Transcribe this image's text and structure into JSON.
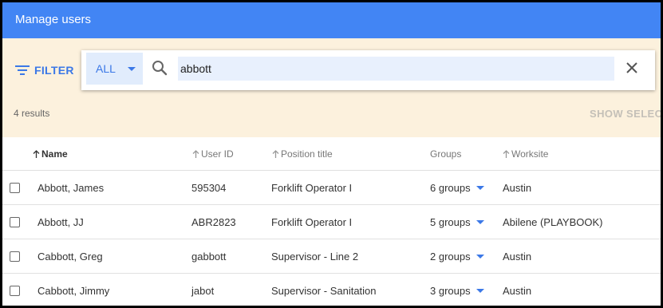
{
  "window": {
    "title": "Manage users"
  },
  "toolbar": {
    "filter_label": "FILTER",
    "scope_value": "ALL",
    "search_value": "abbott",
    "results_text": "4 results",
    "show_selected_label": "SHOW SELECTED"
  },
  "table": {
    "headers": {
      "name": "Name",
      "user_id": "User ID",
      "position": "Position title",
      "groups": "Groups",
      "worksite": "Worksite"
    },
    "rows": [
      {
        "name": "Abbott, James",
        "user_id": "595304",
        "position": "Forklift Operator I",
        "groups": "6 groups",
        "worksite": "Austin"
      },
      {
        "name": "Abbott, JJ",
        "user_id": "ABR2823",
        "position": "Forklift Operator I",
        "groups": "5 groups",
        "worksite": "Abilene (PLAYBOOK)"
      },
      {
        "name": "Cabbott, Greg",
        "user_id": "gabbott",
        "position": "Supervisor - Line 2",
        "groups": "2 groups",
        "worksite": "Austin"
      },
      {
        "name": "Cabbott, Jimmy",
        "user_id": "jabot",
        "position": "Supervisor - Sanitation",
        "groups": "3 groups",
        "worksite": "Austin"
      }
    ]
  },
  "colors": {
    "header": "#4285f4",
    "accent": "#3b78e7",
    "toolbar_bg": "#fcf1dd"
  },
  "icons": [
    "filter-icon",
    "chevron-down-icon",
    "search-icon",
    "close-icon",
    "sort-arrow-icon"
  ]
}
